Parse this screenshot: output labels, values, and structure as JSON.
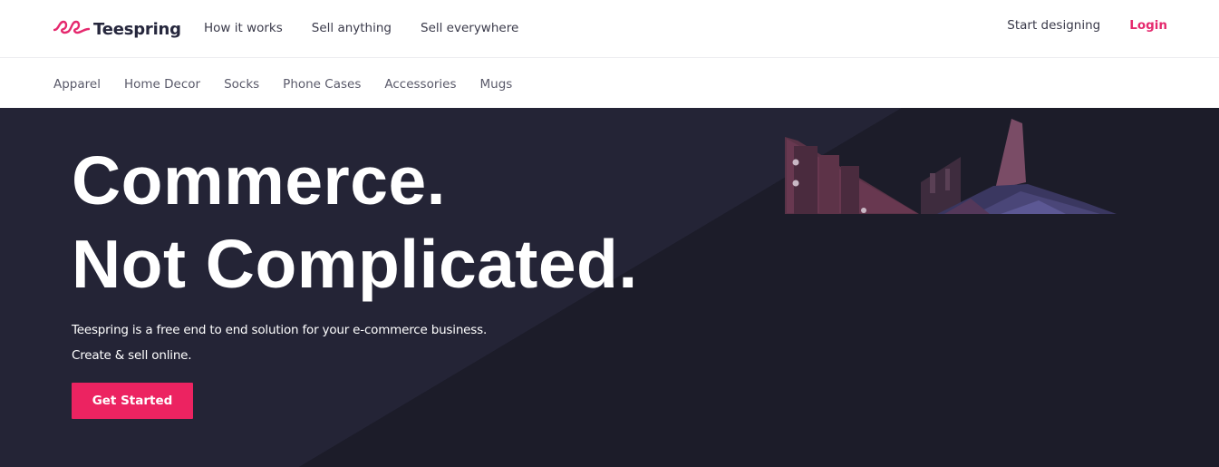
{
  "header": {
    "logo_text": "Teespring",
    "nav": [
      "How it works",
      "Sell anything",
      "Sell everywhere"
    ],
    "start_designing": "Start designing",
    "login": "Login"
  },
  "categories": [
    "Apparel",
    "Home Decor",
    "Socks",
    "Phone Cases",
    "Accessories",
    "Mugs"
  ],
  "hero": {
    "headline_line1": "Commerce.",
    "headline_line2": "Not Complicated.",
    "subtitle_line1": "Teespring is a free end to end solution for your e-commerce business.",
    "subtitle_line2": "Create & sell online.",
    "cta_label": "Get Started"
  },
  "colors": {
    "brand_pink": "#ec2361",
    "login_pink": "#e5296e",
    "hero_dark": "#1a1a26",
    "hero_light": "#242436",
    "logo_text": "#26273d"
  },
  "icons": {
    "logo_mark": "teespring-loop-logo-icon",
    "hero_art": "storefront-rocket-illustration"
  }
}
